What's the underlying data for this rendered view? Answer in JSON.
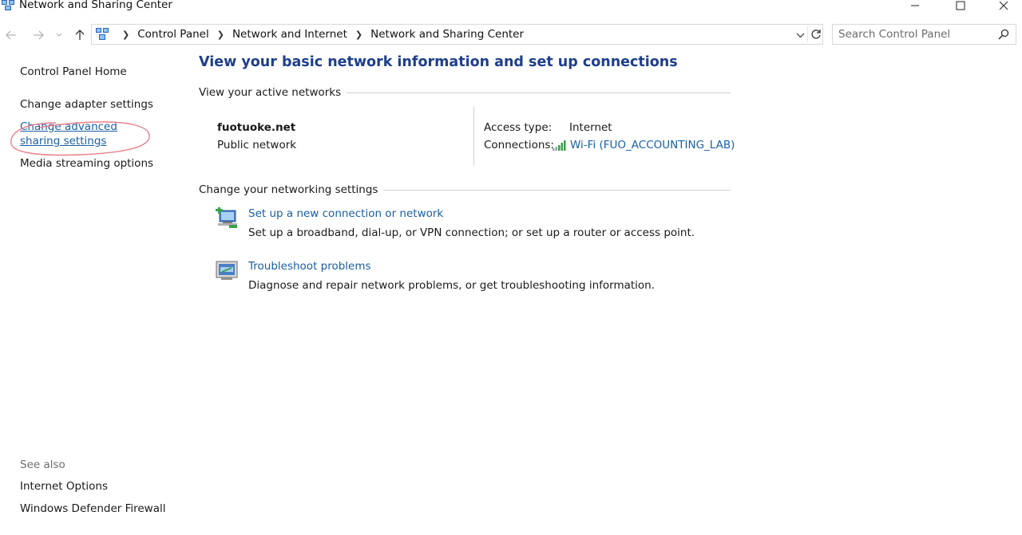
{
  "window": {
    "title": "Network and Sharing Center",
    "icon": "network-control-panel-icon"
  },
  "address": {
    "crumbs": [
      "Control Panel",
      "Network and Internet",
      "Network and Sharing Center"
    ]
  },
  "search": {
    "placeholder": "Search Control Panel"
  },
  "sidebar": {
    "items": [
      {
        "label": "Control Panel Home"
      },
      {
        "label": "Change adapter settings"
      },
      {
        "label": "Change advanced sharing settings"
      },
      {
        "label": "Media streaming options"
      }
    ],
    "see_also_label": "See also",
    "see_also_items": [
      {
        "label": "Internet Options"
      },
      {
        "label": "Windows Defender Firewall"
      }
    ]
  },
  "main": {
    "title": "View your basic network information and set up connections",
    "active_networks_label": "View your active networks",
    "network": {
      "name": "fuotuoke.net",
      "type": "Public network",
      "access_type_label": "Access type:",
      "access_type_value": "Internet",
      "connections_label": "Connections:",
      "connection_name": "Wi-Fi (FUO_ACCOUNTING_LAB)"
    },
    "change_settings_label": "Change your networking settings",
    "tasks": [
      {
        "link": "Set up a new connection or network",
        "description": "Set up a broadband, dial-up, or VPN connection; or set up a router or access point.",
        "icon": "new-connection-icon"
      },
      {
        "link": "Troubleshoot problems",
        "description": "Diagnose and repair network problems, or get troubleshooting information.",
        "icon": "troubleshoot-icon"
      }
    ]
  },
  "colors": {
    "link": "#1a5fa5",
    "title": "#1e3e8c",
    "annotation": "#e8808a"
  }
}
